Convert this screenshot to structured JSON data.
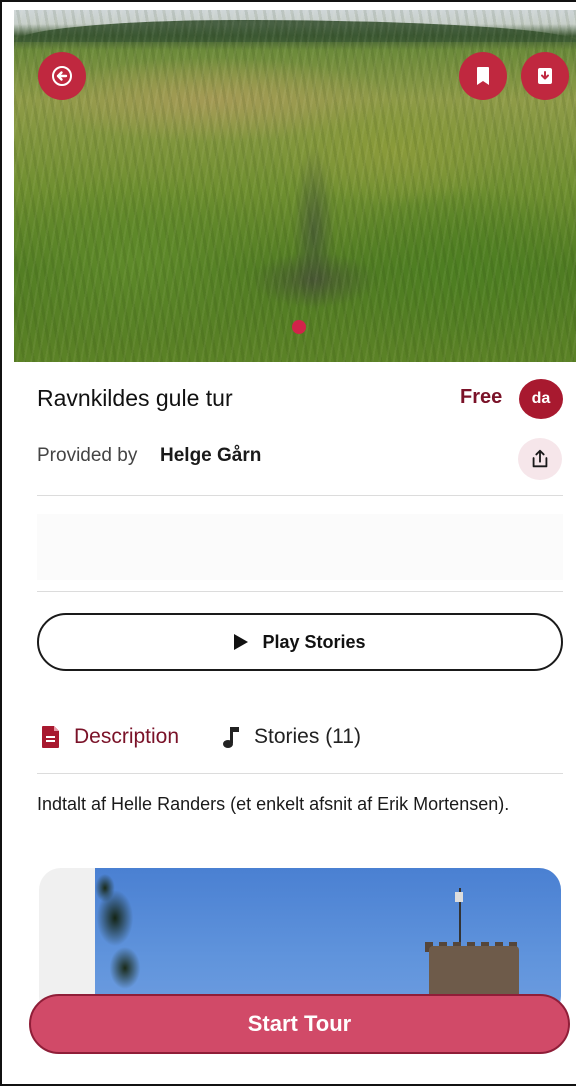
{
  "hero": {
    "image_description_icon": "landscape-photo",
    "page_indicator": {
      "count": 1,
      "active": 0
    },
    "buttons": {
      "back_icon": "arrow-left-icon",
      "bookmark_icon": "bookmark-icon",
      "download_icon": "download-icon"
    }
  },
  "tour": {
    "title": "Ravnkildes gule tur",
    "price": "Free",
    "language_badge": "da",
    "provided_label": "Provided by",
    "provider_name": "Helge Gårn"
  },
  "actions": {
    "play_label": "Play Stories",
    "start_label": "Start Tour"
  },
  "tabs": [
    {
      "label": "Description",
      "icon": "document-icon",
      "active": true
    },
    {
      "label": "Stories (11)",
      "icon": "music-note-icon",
      "active": false
    }
  ],
  "description": {
    "text": "Indtalt af Helle Randers (et enkelt afsnit af Erik Mortensen)."
  },
  "colors": {
    "accent": "#c0283f",
    "accent_dark": "#7a1228",
    "start_button": "#d14a68"
  }
}
